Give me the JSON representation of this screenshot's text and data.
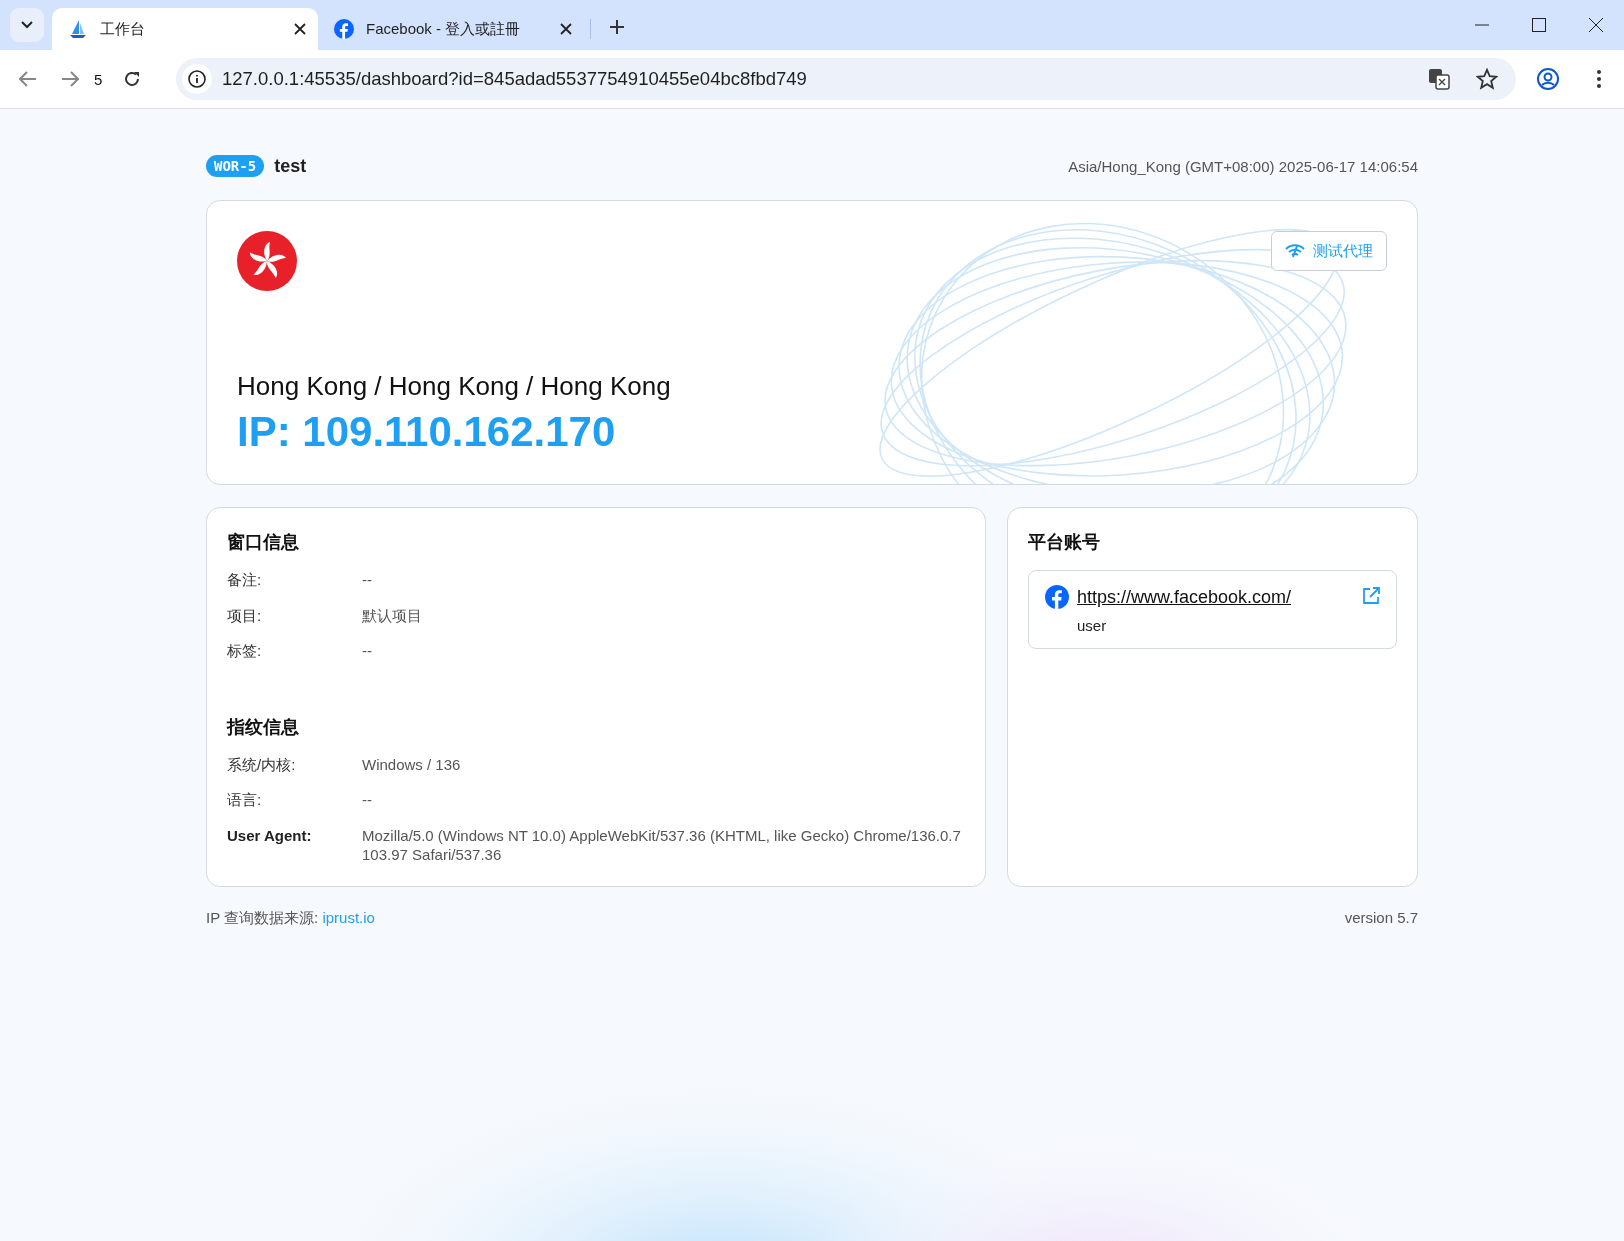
{
  "browser": {
    "tabs": [
      {
        "kind": "app",
        "title": "工作台",
        "selected": true
      },
      {
        "kind": "facebook",
        "title": "Facebook - 登入或註冊",
        "selected": false
      }
    ],
    "history_count": "5",
    "address": "127.0.0.1:45535/dashboard?id=845adad5537754910455e04bc8fbd749"
  },
  "header": {
    "badge": "WOR-5",
    "name": "test",
    "timezone": "Asia/Hong_Kong (GMT+08:00) 2025-06-17 14:06:54"
  },
  "hero": {
    "location": "Hong Kong / Hong Kong / Hong Kong",
    "ip": "IP: 109.110.162.170",
    "test_button": "测试代理"
  },
  "window_info": {
    "title": "窗口信息",
    "rows": [
      {
        "label": "备注:",
        "value": "--",
        "strong": false
      },
      {
        "label": "项目:",
        "value": "默认项目",
        "strong": false
      },
      {
        "label": "标签:",
        "value": "--",
        "strong": false
      }
    ]
  },
  "fingerprint": {
    "title": "指纹信息",
    "rows": [
      {
        "label": "系统/内核:",
        "value": "Windows / 136",
        "strong": false
      },
      {
        "label": "语言:",
        "value": "--",
        "strong": false
      },
      {
        "label": "User Agent:",
        "value": "Mozilla/5.0 (Windows NT 10.0) AppleWebKit/537.36 (KHTML, like Gecko) Chrome/136.0.7103.97 Safari/537.36",
        "strong": true
      }
    ]
  },
  "platform_accounts": {
    "title": "平台账号",
    "accounts": [
      {
        "url": "https://www.facebook.com/",
        "user": "user"
      }
    ]
  },
  "footer": {
    "source_label": "IP 查询数据来源:",
    "source_link": "iprust.io",
    "version": "version 5.7"
  }
}
